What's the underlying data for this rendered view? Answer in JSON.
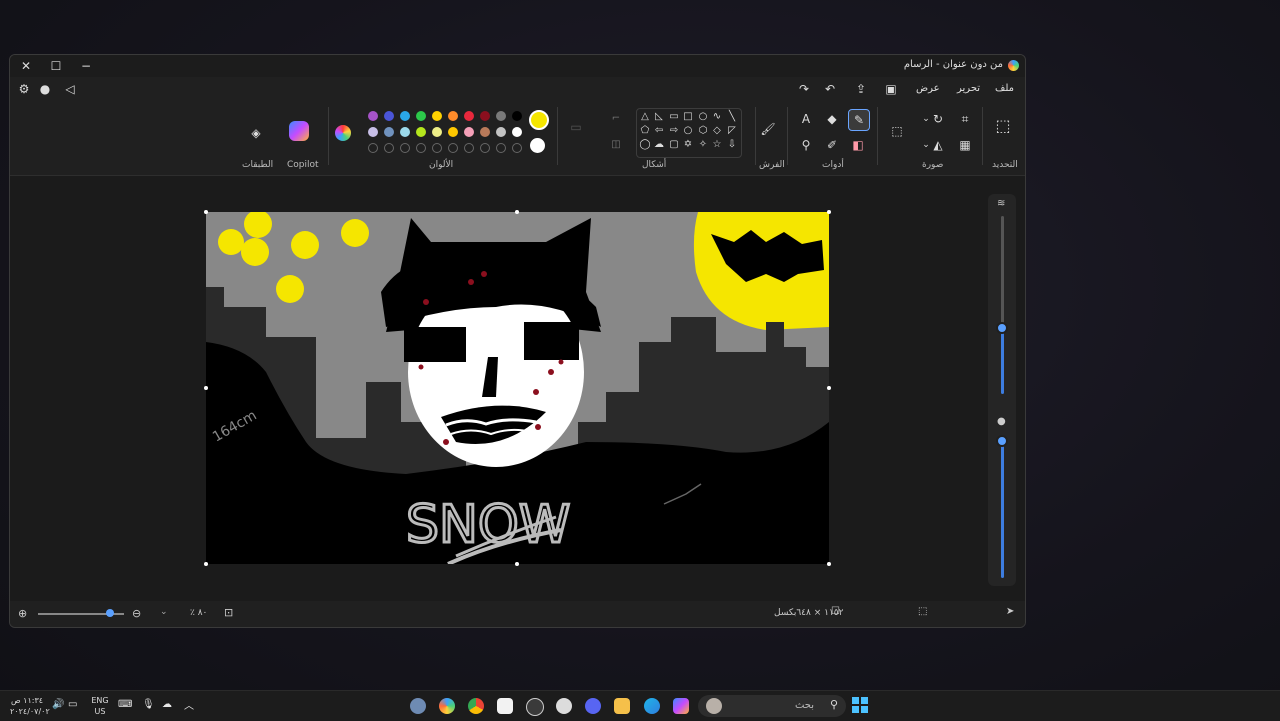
{
  "window": {
    "title": "من دون عنوان - الرسام"
  },
  "menu": {
    "file": "ملف",
    "edit": "تحرير",
    "view": "عرض"
  },
  "ribbon": {
    "groups": {
      "selection": "التحديد",
      "image": "صورة",
      "tools": "أدوات",
      "brushes": "الفرش",
      "shapes": "أشكال",
      "colors": "الألوان",
      "copilot": "Copilot",
      "layers": "الطبقات"
    },
    "colors": {
      "row1": [
        "#000000",
        "#7a7a7a",
        "#8b0f1e",
        "#e8283c",
        "#ff8c2a",
        "#ffd200",
        "#2cc84a",
        "#2aa6e8",
        "#4a55d8",
        "#a653c8"
      ],
      "row2": [
        "#ffffff",
        "#c3c3c3",
        "#b87a5a",
        "#f5a0b8",
        "#ffc800",
        "#eeee88",
        "#b5e61d",
        "#9cd9ea",
        "#7092be",
        "#c8bfe7"
      ],
      "primary": "#f5e600",
      "secondary": "#ffffff"
    }
  },
  "status": {
    "canvas_size": "١١٥٢ × ٦٤٨بكسل",
    "zoom": "٨٠ ٪"
  },
  "canvas_text": {
    "snow": "SNOW",
    "height": "164cm"
  },
  "taskbar": {
    "search_placeholder": "بحث",
    "language_top": "ENG",
    "language_bottom": "US",
    "time": "١١:٣٤ ص",
    "date": "٢٠٢٤/٠٧/٠٢"
  }
}
